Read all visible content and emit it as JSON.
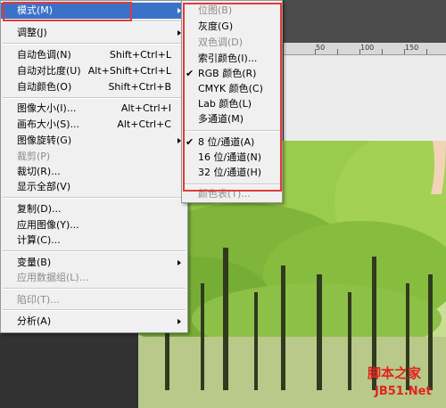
{
  "main_menu": {
    "items": [
      {
        "label": "模式(M)",
        "shortcut": "",
        "submenu": true,
        "disabled": false,
        "selected": true
      },
      {
        "label": "调整(J)",
        "shortcut": "",
        "submenu": true,
        "disabled": false
      },
      {
        "label": "自动色调(N)",
        "shortcut": "Shift+Ctrl+L",
        "submenu": false,
        "disabled": false
      },
      {
        "label": "自动对比度(U)",
        "shortcut": "Alt+Shift+Ctrl+L",
        "submenu": false,
        "disabled": false
      },
      {
        "label": "自动颜色(O)",
        "shortcut": "Shift+Ctrl+B",
        "submenu": false,
        "disabled": false
      },
      {
        "label": "图像大小(I)...",
        "shortcut": "Alt+Ctrl+I",
        "submenu": false,
        "disabled": false
      },
      {
        "label": "画布大小(S)...",
        "shortcut": "Alt+Ctrl+C",
        "submenu": false,
        "disabled": false
      },
      {
        "label": "图像旋转(G)",
        "shortcut": "",
        "submenu": true,
        "disabled": false
      },
      {
        "label": "裁剪(P)",
        "shortcut": "",
        "submenu": false,
        "disabled": true
      },
      {
        "label": "裁切(R)...",
        "shortcut": "",
        "submenu": false,
        "disabled": false
      },
      {
        "label": "显示全部(V)",
        "shortcut": "",
        "submenu": false,
        "disabled": false
      },
      {
        "label": "复制(D)...",
        "shortcut": "",
        "submenu": false,
        "disabled": false
      },
      {
        "label": "应用图像(Y)...",
        "shortcut": "",
        "submenu": false,
        "disabled": false
      },
      {
        "label": "计算(C)...",
        "shortcut": "",
        "submenu": false,
        "disabled": false
      },
      {
        "label": "变量(B)",
        "shortcut": "",
        "submenu": true,
        "disabled": false
      },
      {
        "label": "应用数据组(L)...",
        "shortcut": "",
        "submenu": false,
        "disabled": true
      },
      {
        "label": "陷印(T)...",
        "shortcut": "",
        "submenu": false,
        "disabled": true
      },
      {
        "label": "分析(A)",
        "shortcut": "",
        "submenu": true,
        "disabled": false
      }
    ]
  },
  "sub_menu": {
    "items": [
      {
        "label": "位图(B)",
        "disabled": true,
        "checked": false
      },
      {
        "label": "灰度(G)",
        "disabled": false,
        "checked": false
      },
      {
        "label": "双色调(D)",
        "disabled": true,
        "checked": false
      },
      {
        "label": "索引颜色(I)...",
        "disabled": false,
        "checked": false
      },
      {
        "label": "RGB 颜色(R)",
        "disabled": false,
        "checked": true
      },
      {
        "label": "CMYK 颜色(C)",
        "disabled": false,
        "checked": false
      },
      {
        "label": "Lab 颜色(L)",
        "disabled": false,
        "checked": false
      },
      {
        "label": "多通道(M)",
        "disabled": false,
        "checked": false
      },
      {
        "label": "8 位/通道(A)",
        "disabled": false,
        "checked": true
      },
      {
        "label": "16 位/通道(N)",
        "disabled": false,
        "checked": false
      },
      {
        "label": "32 位/通道(H)",
        "disabled": false,
        "checked": false
      },
      {
        "label": "颜色表(T)...",
        "disabled": true,
        "checked": false
      }
    ],
    "check_glyph": "✔"
  },
  "ruler": {
    "labels": [
      "50",
      "100",
      "150"
    ]
  },
  "watermark": {
    "line1": "脚本之家",
    "line2": "JB51.Net"
  },
  "colors": {
    "highlight": "#3a72c9",
    "annotation": "#e23a3a",
    "watermark_red": "#e0231f"
  }
}
